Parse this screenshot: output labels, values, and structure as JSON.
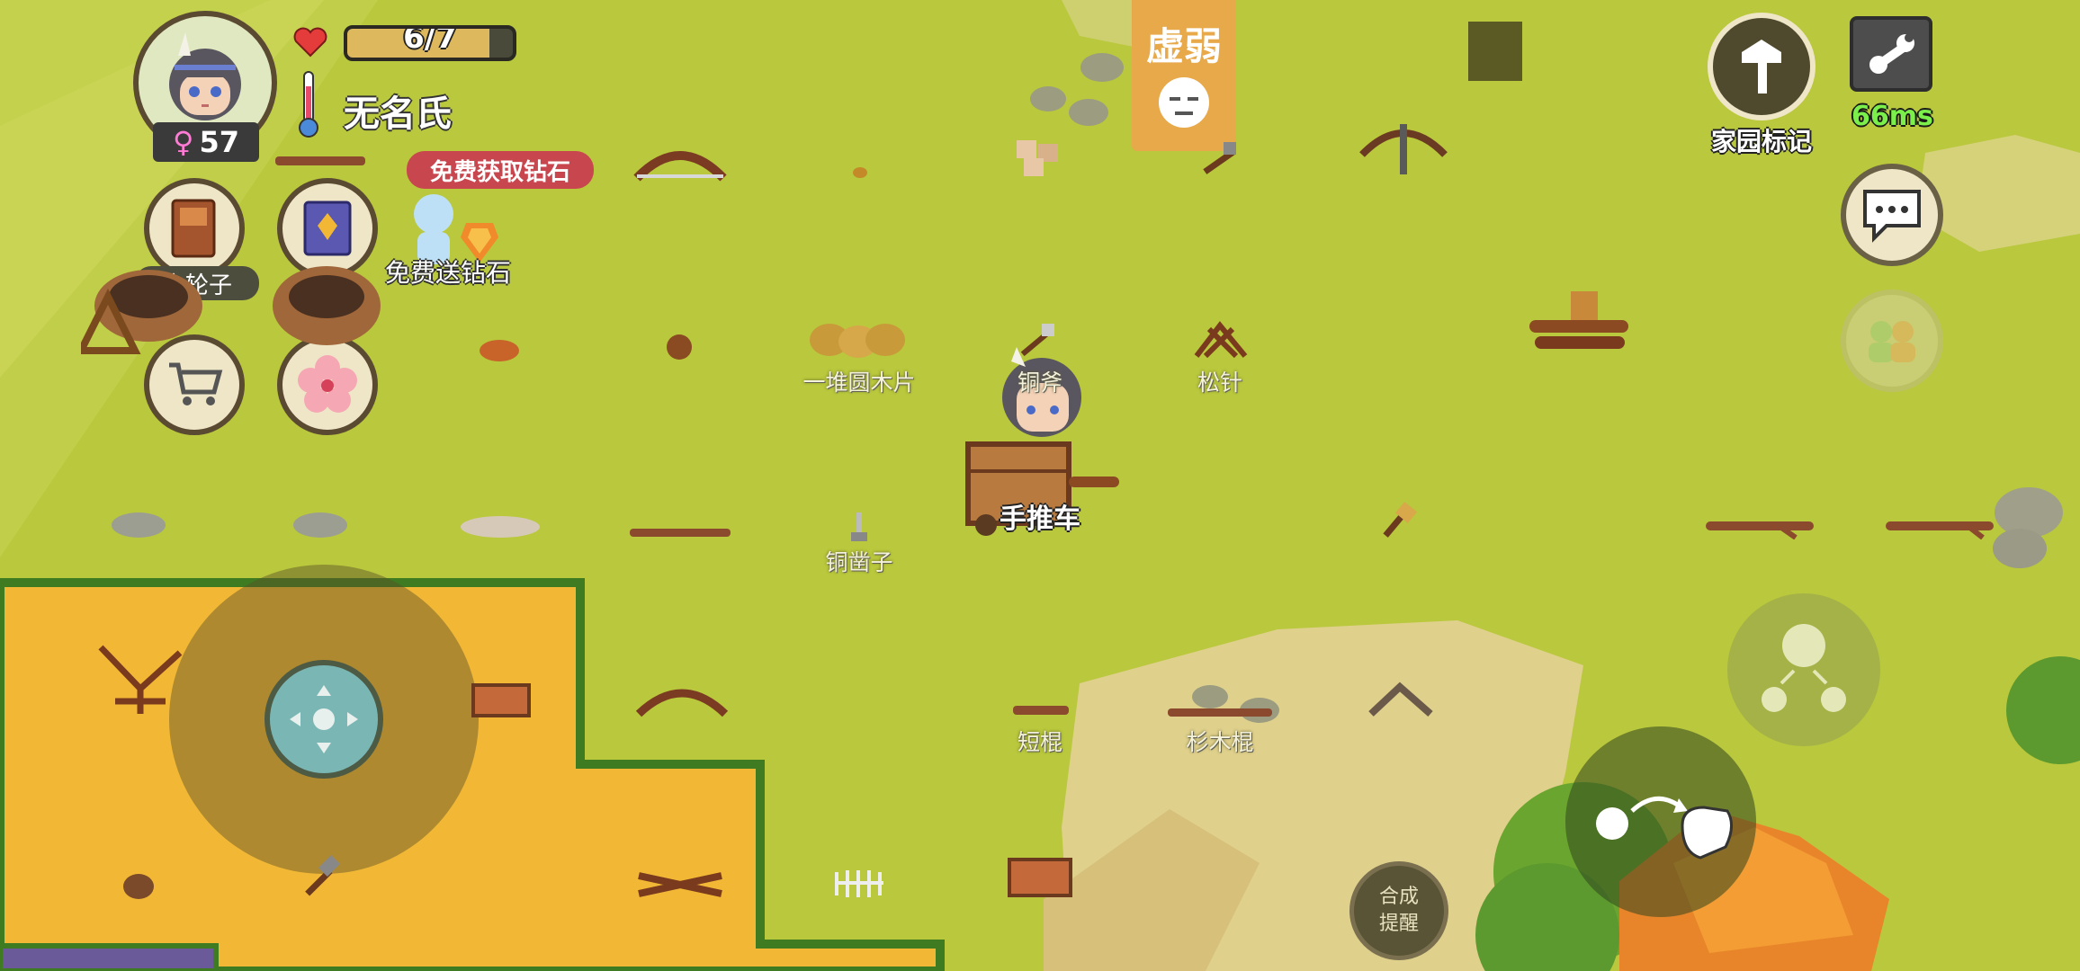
{
  "player": {
    "health_text": "6/7",
    "health_fraction": 0.857,
    "name": "无名氏",
    "gender_symbol": "♀",
    "age": "57",
    "portrait_icon": "girl-portrait-icon"
  },
  "status_effect": {
    "label": "虚弱",
    "icon": "weak-face-icon"
  },
  "top_right": {
    "home_marker_label": "家园标记",
    "ping": "66ms"
  },
  "left_menu": {
    "diamond_banner": "免费获取钻石",
    "free_diamond_label": "免费送钻石",
    "recipe_book_label": "木轮子"
  },
  "world_labels": {
    "wood_chips": "一堆圆木片",
    "copper_axe": "铜斧",
    "pine_needles": "松针",
    "cart": "手推车",
    "copper_chisel": "铜凿子",
    "short_stick": "短棍",
    "fir_stick": "杉木棍"
  },
  "craft_hint": "合成\n提醒",
  "colors": {
    "grass": "#b9c83c",
    "sand": "#f2b835",
    "hud_brown": "#5b4a32",
    "ping_green": "#7cf04a",
    "banner_red": "#c8464e",
    "status_orange": "#e7a94a"
  }
}
